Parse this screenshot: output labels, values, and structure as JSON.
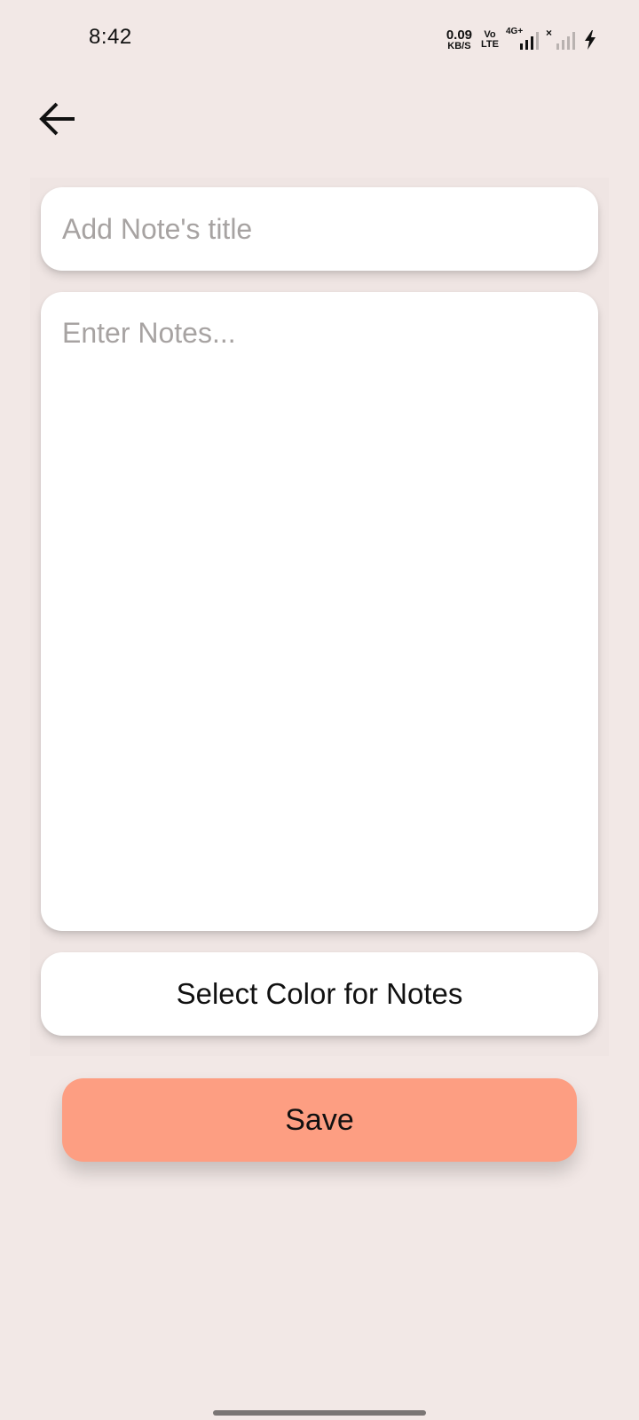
{
  "status_bar": {
    "time": "8:42",
    "net_speed_value": "0.09",
    "net_speed_unit": "KB/S",
    "volte_top": "Vo",
    "volte_bottom": "LTE",
    "network_type": "4G+",
    "icons": [
      "network-speed-icon",
      "volte-icon",
      "signal-4g-icon",
      "signal-no-service-icon",
      "charging-icon"
    ]
  },
  "toolbar": {
    "back_icon": "arrow-left-icon"
  },
  "form": {
    "title_placeholder": "Add Note's title",
    "title_value": "",
    "notes_placeholder": "Enter Notes...",
    "notes_value": "",
    "color_button_label": "Select Color for Notes",
    "save_label": "Save"
  },
  "colors": {
    "background": "#f2e8e6",
    "field_background": "#ffffff",
    "save_button": "#fd9e82",
    "placeholder": "#a7a3a2"
  }
}
